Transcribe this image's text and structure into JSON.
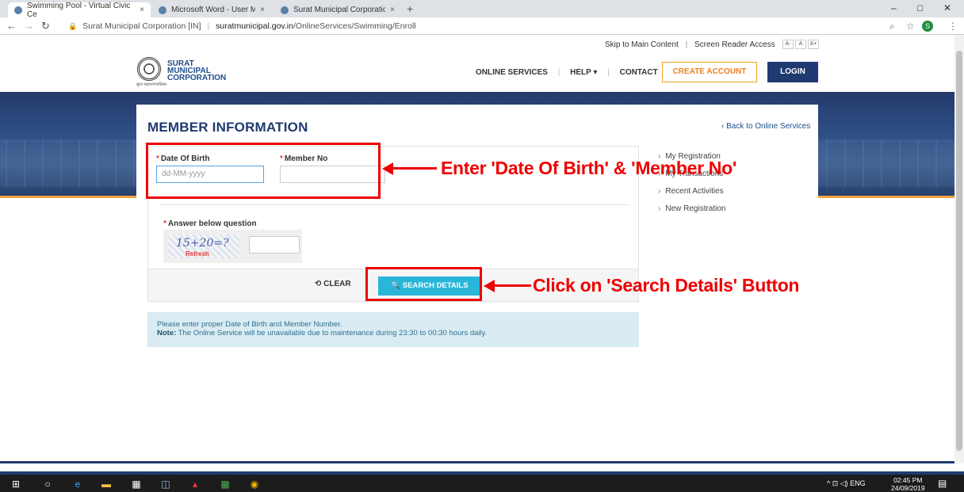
{
  "browser": {
    "tabs": [
      {
        "label": "Swimming Pool - Virtual Civic Ce",
        "close": "×"
      },
      {
        "label": "Microsoft Word - User Manual fo",
        "close": "×"
      },
      {
        "label": "Surat Municipal Corporation - Ap",
        "close": "×"
      }
    ],
    "new_tab": "+",
    "url_site": "Surat Municipal Corporation [IN]",
    "url_domain": "suratmunicipal.gov.in",
    "url_path": "/OnlineServices/Swimming/Enroll",
    "profile_initial": "S",
    "window_controls": [
      "–",
      "□",
      "✕"
    ]
  },
  "topstrip": {
    "skip": "Skip to Main Content",
    "reader": "Screen Reader Access",
    "font_small": "A-",
    "font_normal": "A",
    "font_large": "A+"
  },
  "header": {
    "logo_line1": "SURAT",
    "logo_line2": "MUNICIPAL",
    "logo_line3": "CORPORATION",
    "logo_sub": "सुरत महानगरपालिका",
    "nav_online": "ONLINE SERVICES",
    "nav_help": "HELP ▾",
    "nav_contact": "CONTACT",
    "create_account": "CREATE ACCOUNT",
    "login": "LOGIN"
  },
  "main": {
    "title": "MEMBER INFORMATION",
    "back_link": "‹ Back to Online Services",
    "dob_label": "Date Of Birth",
    "dob_placeholder": "dd-MM-yyyy",
    "member_label": "Member No",
    "member_value": "",
    "required_mark": "*",
    "captcha_label": "Answer below question",
    "captcha_question": "15+20=?",
    "captcha_refresh": "Refresh",
    "clear": "⟲ CLEAR",
    "search": "🔍 SEARCH DETAILS",
    "info_line1": "Please enter proper Date of Birth and Member Number.",
    "info_note_label": "Note:",
    "info_note": " The Online Service will be unavailable due to maintenance during 23:30 to 00:30 hours daily."
  },
  "sidebar": {
    "chevron": "›",
    "items": [
      {
        "label": "My Registration"
      },
      {
        "label": "My Transactions"
      },
      {
        "label": "Recent Activities"
      },
      {
        "label": "New Registration"
      }
    ]
  },
  "annotations": {
    "dob_member": "Enter 'Date Of Birth' & 'Member No'",
    "search_btn": "Click on 'Search Details' Button",
    "color": "#e00000"
  },
  "taskbar": {
    "system": "^  ⊡  ◁)  ENG",
    "time": "02:45 PM",
    "date": "24/09/2019"
  }
}
